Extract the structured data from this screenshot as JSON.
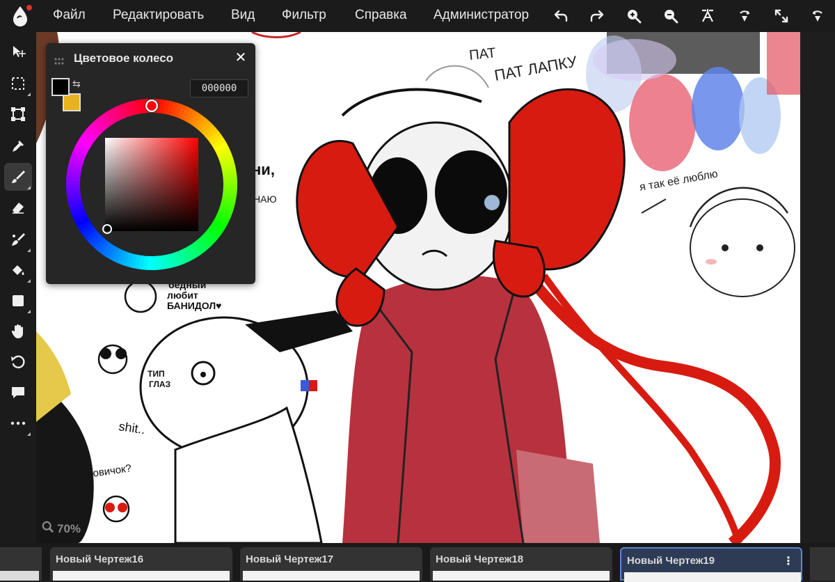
{
  "menu": {
    "items": [
      "Файл",
      "Редактировать",
      "Вид",
      "Фильтр",
      "Справка",
      "Администратор"
    ]
  },
  "top_tools": [
    "undo-icon",
    "redo-icon",
    "zoom-in-icon",
    "zoom-out-icon",
    "crop-icon",
    "hand-rotate-icon",
    "fullscreen-icon",
    "rotate-view-icon"
  ],
  "left_tools": [
    "move-icon",
    "selection-icon",
    "transform-icon",
    "eyedropper-icon",
    "brush-icon",
    "eraser-icon",
    "smudge-icon",
    "fill-icon",
    "shape-icon",
    "hand-icon",
    "rotate-icon",
    "comment-icon",
    "more-icon"
  ],
  "color_panel": {
    "title": "Цветовое колесо",
    "hex": "000000",
    "foreground": "#000000",
    "background": "#e8b21c",
    "hue_color": "#ff0000"
  },
  "canvas": {
    "zoom": "70%",
    "texts": {
      "pat": "ПАТ",
      "pat_lapku": "ПАТ ЛАПКУ",
      "ya_tak": "я так её люблю",
      "bednyi": "бедный",
      "lyubit": "любит",
      "banidol": "БАНИДОЛ♥",
      "tip": "ТИП",
      "glaz": "ГЛАЗ",
      "shit": "shit..",
      "novichok": "новичок?",
      "ni": "ни,",
      "nayu": "НАЮ"
    }
  },
  "tabs": [
    {
      "label": "Новый Чертеж16",
      "active": false
    },
    {
      "label": "Новый Чертеж17",
      "active": false
    },
    {
      "label": "Новый Чертеж18",
      "active": false
    },
    {
      "label": "Новый Чертеж19",
      "active": true
    }
  ],
  "colors": {
    "menubar": "#1b1b1b",
    "panel": "#262626",
    "active_tab": "#2d3b55",
    "accent": "#5b86d4",
    "red_bow": "#d81b10",
    "coat": "#b7323e"
  }
}
